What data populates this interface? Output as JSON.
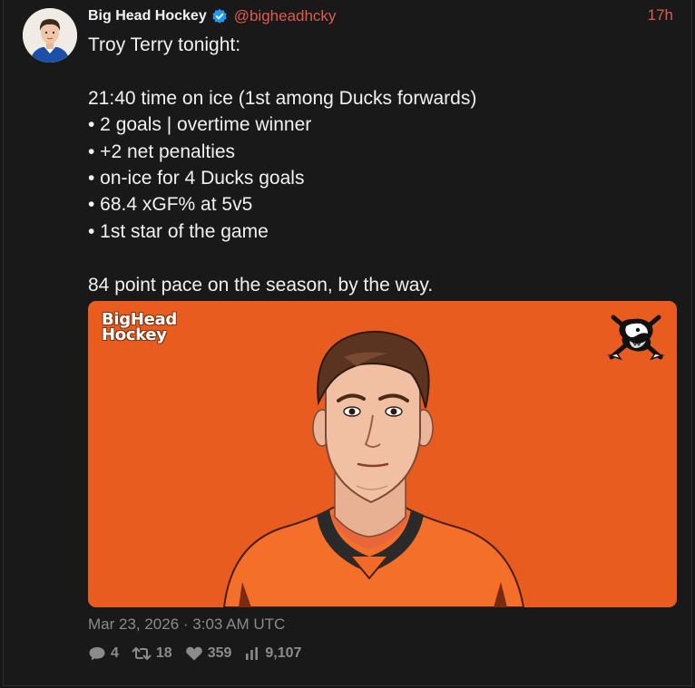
{
  "tweet": {
    "display_name": "Big Head Hockey",
    "handle": "@bigheadhcky",
    "time_ago": "17h",
    "lines": [
      "Troy Terry tonight:",
      "",
      "21:40 time on ice (1st among Ducks forwards)",
      "• 2 goals | overtime winner",
      "• +2 net penalties",
      "• on-ice for 4 Ducks goals",
      "• 68.4 xGF% at 5v5",
      "• 1st star of the game",
      "",
      "84 point pace on the season, by the way."
    ],
    "timestamp": "Mar 23, 2026 · 3:03 AM UTC"
  },
  "media": {
    "brand_line1": "BigHead",
    "brand_line2": "Hockey",
    "background_color": "#e85d1f",
    "logo_icon": "ducks-logo-icon"
  },
  "stats": {
    "replies": "4",
    "retweets": "18",
    "likes": "359",
    "views": "9,107"
  },
  "colors": {
    "accent": "#e05a4e",
    "verified": "#1d9bf0",
    "muted": "#8b8b8b",
    "background": "#191919"
  }
}
